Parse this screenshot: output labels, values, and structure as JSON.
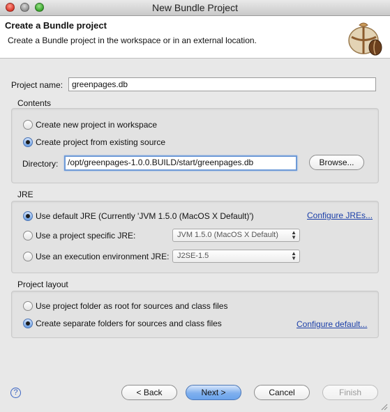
{
  "window": {
    "title": "New Bundle Project"
  },
  "header": {
    "title": "Create a Bundle project",
    "description": "Create a Bundle project in the workspace or in an external location."
  },
  "project_name": {
    "label": "Project name:",
    "value": "greenpages.db"
  },
  "contents": {
    "title": "Contents",
    "option_new": "Create new project in workspace",
    "option_existing": "Create project from existing source",
    "directory_label": "Directory:",
    "directory_value": "/opt/greenpages-1.0.0.BUILD/start/greenpages.db",
    "browse_label": "Browse..."
  },
  "jre": {
    "title": "JRE",
    "option_default": "Use default JRE (Currently 'JVM 1.5.0 (MacOS X Default)')",
    "configure_link": "Configure JREs...",
    "option_specific": "Use a project specific JRE:",
    "specific_selected": "JVM 1.5.0 (MacOS X Default)",
    "option_env": "Use an execution environment JRE:",
    "env_selected": "J2SE-1.5"
  },
  "layout": {
    "title": "Project layout",
    "option_root": "Use project folder as root for sources and class files",
    "option_separate": "Create separate folders for sources and class files",
    "configure_link": "Configure default..."
  },
  "footer": {
    "help_icon": "?",
    "back_label": "< Back",
    "next_label": "Next >",
    "cancel_label": "Cancel",
    "finish_label": "Finish"
  },
  "colors": {
    "accent": "#6aa3ec",
    "link": "#1a3ea8",
    "header_bg": "#ffffff",
    "dialog_bg": "#e8e8e8"
  }
}
